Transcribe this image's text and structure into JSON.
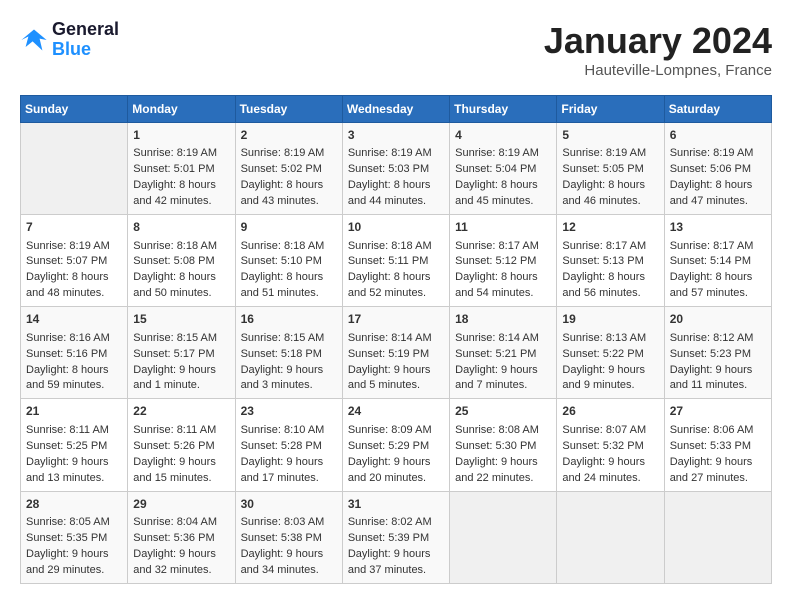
{
  "logo": {
    "line1": "General",
    "line2": "Blue"
  },
  "title": "January 2024",
  "location": "Hauteville-Lompnes, France",
  "days_of_week": [
    "Sunday",
    "Monday",
    "Tuesday",
    "Wednesday",
    "Thursday",
    "Friday",
    "Saturday"
  ],
  "weeks": [
    [
      {
        "day": "",
        "info": ""
      },
      {
        "day": "1",
        "info": "Sunrise: 8:19 AM\nSunset: 5:01 PM\nDaylight: 8 hours\nand 42 minutes."
      },
      {
        "day": "2",
        "info": "Sunrise: 8:19 AM\nSunset: 5:02 PM\nDaylight: 8 hours\nand 43 minutes."
      },
      {
        "day": "3",
        "info": "Sunrise: 8:19 AM\nSunset: 5:03 PM\nDaylight: 8 hours\nand 44 minutes."
      },
      {
        "day": "4",
        "info": "Sunrise: 8:19 AM\nSunset: 5:04 PM\nDaylight: 8 hours\nand 45 minutes."
      },
      {
        "day": "5",
        "info": "Sunrise: 8:19 AM\nSunset: 5:05 PM\nDaylight: 8 hours\nand 46 minutes."
      },
      {
        "day": "6",
        "info": "Sunrise: 8:19 AM\nSunset: 5:06 PM\nDaylight: 8 hours\nand 47 minutes."
      }
    ],
    [
      {
        "day": "7",
        "info": "Sunrise: 8:19 AM\nSunset: 5:07 PM\nDaylight: 8 hours\nand 48 minutes."
      },
      {
        "day": "8",
        "info": "Sunrise: 8:18 AM\nSunset: 5:08 PM\nDaylight: 8 hours\nand 50 minutes."
      },
      {
        "day": "9",
        "info": "Sunrise: 8:18 AM\nSunset: 5:10 PM\nDaylight: 8 hours\nand 51 minutes."
      },
      {
        "day": "10",
        "info": "Sunrise: 8:18 AM\nSunset: 5:11 PM\nDaylight: 8 hours\nand 52 minutes."
      },
      {
        "day": "11",
        "info": "Sunrise: 8:17 AM\nSunset: 5:12 PM\nDaylight: 8 hours\nand 54 minutes."
      },
      {
        "day": "12",
        "info": "Sunrise: 8:17 AM\nSunset: 5:13 PM\nDaylight: 8 hours\nand 56 minutes."
      },
      {
        "day": "13",
        "info": "Sunrise: 8:17 AM\nSunset: 5:14 PM\nDaylight: 8 hours\nand 57 minutes."
      }
    ],
    [
      {
        "day": "14",
        "info": "Sunrise: 8:16 AM\nSunset: 5:16 PM\nDaylight: 8 hours\nand 59 minutes."
      },
      {
        "day": "15",
        "info": "Sunrise: 8:15 AM\nSunset: 5:17 PM\nDaylight: 9 hours\nand 1 minute."
      },
      {
        "day": "16",
        "info": "Sunrise: 8:15 AM\nSunset: 5:18 PM\nDaylight: 9 hours\nand 3 minutes."
      },
      {
        "day": "17",
        "info": "Sunrise: 8:14 AM\nSunset: 5:19 PM\nDaylight: 9 hours\nand 5 minutes."
      },
      {
        "day": "18",
        "info": "Sunrise: 8:14 AM\nSunset: 5:21 PM\nDaylight: 9 hours\nand 7 minutes."
      },
      {
        "day": "19",
        "info": "Sunrise: 8:13 AM\nSunset: 5:22 PM\nDaylight: 9 hours\nand 9 minutes."
      },
      {
        "day": "20",
        "info": "Sunrise: 8:12 AM\nSunset: 5:23 PM\nDaylight: 9 hours\nand 11 minutes."
      }
    ],
    [
      {
        "day": "21",
        "info": "Sunrise: 8:11 AM\nSunset: 5:25 PM\nDaylight: 9 hours\nand 13 minutes."
      },
      {
        "day": "22",
        "info": "Sunrise: 8:11 AM\nSunset: 5:26 PM\nDaylight: 9 hours\nand 15 minutes."
      },
      {
        "day": "23",
        "info": "Sunrise: 8:10 AM\nSunset: 5:28 PM\nDaylight: 9 hours\nand 17 minutes."
      },
      {
        "day": "24",
        "info": "Sunrise: 8:09 AM\nSunset: 5:29 PM\nDaylight: 9 hours\nand 20 minutes."
      },
      {
        "day": "25",
        "info": "Sunrise: 8:08 AM\nSunset: 5:30 PM\nDaylight: 9 hours\nand 22 minutes."
      },
      {
        "day": "26",
        "info": "Sunrise: 8:07 AM\nSunset: 5:32 PM\nDaylight: 9 hours\nand 24 minutes."
      },
      {
        "day": "27",
        "info": "Sunrise: 8:06 AM\nSunset: 5:33 PM\nDaylight: 9 hours\nand 27 minutes."
      }
    ],
    [
      {
        "day": "28",
        "info": "Sunrise: 8:05 AM\nSunset: 5:35 PM\nDaylight: 9 hours\nand 29 minutes."
      },
      {
        "day": "29",
        "info": "Sunrise: 8:04 AM\nSunset: 5:36 PM\nDaylight: 9 hours\nand 32 minutes."
      },
      {
        "day": "30",
        "info": "Sunrise: 8:03 AM\nSunset: 5:38 PM\nDaylight: 9 hours\nand 34 minutes."
      },
      {
        "day": "31",
        "info": "Sunrise: 8:02 AM\nSunset: 5:39 PM\nDaylight: 9 hours\nand 37 minutes."
      },
      {
        "day": "",
        "info": ""
      },
      {
        "day": "",
        "info": ""
      },
      {
        "day": "",
        "info": ""
      }
    ]
  ]
}
